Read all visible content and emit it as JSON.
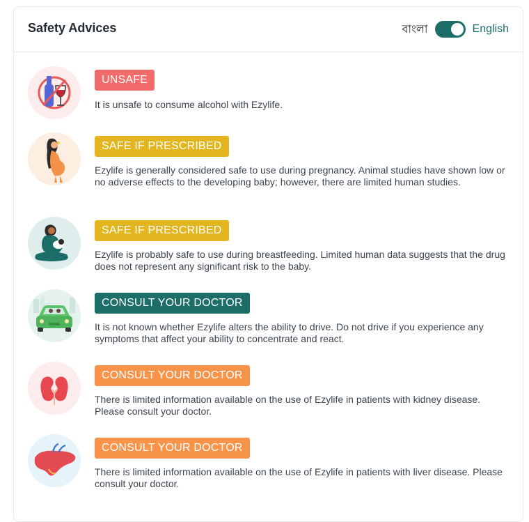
{
  "header": {
    "title": "Safety Advices",
    "lang_bangla": "বাংলা",
    "lang_english": "English",
    "toggle_state": "english"
  },
  "colors": {
    "unsafe": "#f26b6b",
    "safe_if_prescribed": "#e3b51e",
    "consult_teal": "#1d6d68",
    "consult_orange": "#f7944a",
    "brand_teal": "#1d6d68"
  },
  "advices": [
    {
      "icon": "alcohol-icon",
      "badge": "UNSAFE",
      "badge_color": "#f26b6b",
      "text": "It is unsafe to consume alcohol with Ezylife."
    },
    {
      "icon": "pregnancy-icon",
      "badge": "SAFE IF PRESCRIBED",
      "badge_color": "#e3b51e",
      "text": "Ezylife is generally considered safe to use during pregnancy. Animal studies have shown low or no adverse effects to the developing baby; however, there are limited human studies."
    },
    {
      "icon": "breastfeeding-icon",
      "badge": "SAFE IF PRESCRIBED",
      "badge_color": "#e3b51e",
      "text": "Ezylife is probably safe to use during breastfeeding. Limited human data suggests that the drug does not represent any significant risk to the baby."
    },
    {
      "icon": "driving-icon",
      "badge": "CONSULT YOUR DOCTOR",
      "badge_color": "#1d6d68",
      "text": "It is not known whether Ezylife alters the ability to drive. Do not drive if you experience any symptoms that affect your ability to concentrate and react."
    },
    {
      "icon": "kidney-icon",
      "badge": "CONSULT YOUR DOCTOR",
      "badge_color": "#f7944a",
      "text": "There is limited information available on the use of Ezylife in patients with kidney disease. Please consult your doctor."
    },
    {
      "icon": "liver-icon",
      "badge": "CONSULT YOUR DOCTOR",
      "badge_color": "#f7944a",
      "text": "There is limited information available on the use of Ezylife in patients with liver disease. Please consult your doctor."
    }
  ]
}
